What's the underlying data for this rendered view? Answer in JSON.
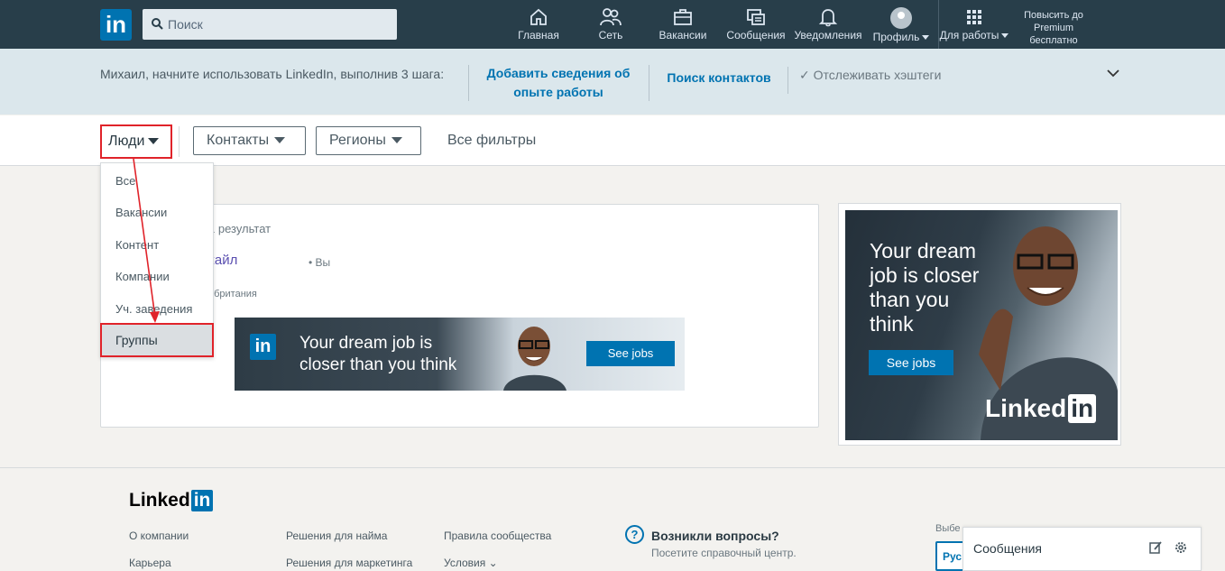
{
  "app": {
    "logo_text": "in"
  },
  "search": {
    "placeholder": "Поиск"
  },
  "nav": {
    "items": [
      {
        "label": "Главная",
        "icon": "home-icon"
      },
      {
        "label": "Сеть",
        "icon": "network-icon"
      },
      {
        "label": "Вакансии",
        "icon": "briefcase-icon"
      },
      {
        "label": "Сообщения",
        "icon": "messaging-icon"
      },
      {
        "label": "Уведомления",
        "icon": "bell-icon"
      },
      {
        "label": "Профиль",
        "icon": "avatar"
      },
      {
        "label": "Для работы",
        "icon": "grid-icon"
      }
    ],
    "premium": "Повысить до Premium бесплатно"
  },
  "onboarding": {
    "intro": "Михаил, начните использовать LinkedIn, выполнив 3 шага:",
    "step1": "Добавить сведения об опыте работы",
    "step2": "Поиск контактов",
    "step3": "Отслеживать хэштеги"
  },
  "filters": {
    "people": "Люди",
    "contacts": "Контакты",
    "regions": "Регионы",
    "all": "Все фильтры"
  },
  "dropdown": {
    "items": [
      "Все",
      "Вакансии",
      "Контент",
      "Компании",
      "Уч. заведения"
    ],
    "selected": "Группы"
  },
  "results": {
    "count": "1 результат",
    "name": "кайл",
    "you": "• Вы",
    "location": "обритания"
  },
  "ad_wide": {
    "logo": "in",
    "text_line1": "Your dream job is",
    "text_line2": "closer than you think",
    "button": "See jobs"
  },
  "ad_side": {
    "text": [
      "Your dream",
      "job is closer",
      "than you",
      "think"
    ],
    "button": "See jobs",
    "brand": "Linked",
    "brand_in": "in"
  },
  "footer": {
    "logo": "Linked",
    "logo_in": "in",
    "col1": [
      "О компании",
      "Карьера"
    ],
    "col2": [
      "Решения для найма",
      "Решения для маркетинга"
    ],
    "col3": [
      "Правила сообщества",
      "Условия"
    ],
    "help_title": "Возникли вопросы?",
    "help_sub": "Посетите справочный центр.",
    "lang_label": "Выбе",
    "lang_value": "Рус"
  },
  "messaging": {
    "label": "Сообщения"
  },
  "colors": {
    "nav_bg": "#283e4a",
    "accent": "#0073b1",
    "highlight": "#e0232a"
  }
}
